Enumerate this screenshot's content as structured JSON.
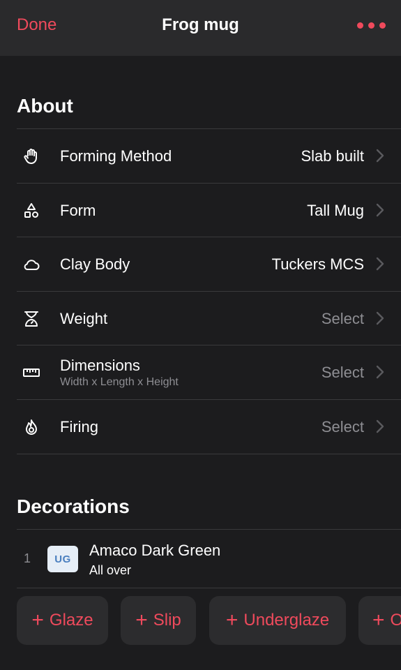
{
  "nav": {
    "done_label": "Done",
    "title": "Frog mug",
    "more_icon": "ellipsis-icon",
    "accent": "#ef4a5c"
  },
  "about": {
    "title": "About",
    "rows": [
      {
        "icon": "hand-icon",
        "label": "Forming Method",
        "value": "Slab built",
        "placeholder": false
      },
      {
        "icon": "shapes-icon",
        "label": "Form",
        "value": "Tall Mug",
        "placeholder": false
      },
      {
        "icon": "cloud-icon",
        "label": "Clay Body",
        "value": "Tuckers MCS",
        "placeholder": false
      },
      {
        "icon": "scale-icon",
        "label": "Weight",
        "value": "Select",
        "placeholder": true
      },
      {
        "icon": "ruler-icon",
        "label": "Dimensions",
        "sublabel": "Width x Length x Height",
        "value": "Select",
        "placeholder": true
      },
      {
        "icon": "flame-icon",
        "label": "Firing",
        "value": "Select",
        "placeholder": true
      }
    ]
  },
  "decorations": {
    "title": "Decorations",
    "items": [
      {
        "index": "1",
        "badge": "UG",
        "name": "Amaco Dark Green",
        "coverage": "All over"
      }
    ],
    "add_buttons": [
      {
        "plus": "+",
        "label": "Glaze"
      },
      {
        "plus": "+",
        "label": "Slip"
      },
      {
        "plus": "+",
        "label": "Underglaze"
      },
      {
        "plus": "+",
        "label": "O"
      }
    ]
  }
}
